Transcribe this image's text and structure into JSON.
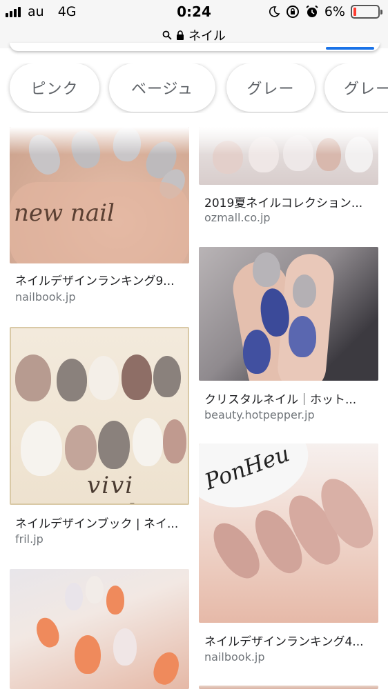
{
  "status_bar": {
    "carrier": "au",
    "network": "4G",
    "time": "0:24",
    "battery": "6%",
    "battery_level": 0.06,
    "icons": [
      "signal-bars-icon",
      "moon-icon",
      "rotation-lock-icon",
      "alarm-icon",
      "battery-icon"
    ]
  },
  "url_bar": {
    "query": "ネイル",
    "icons": [
      "search-icon",
      "lock-icon"
    ]
  },
  "chips": [
    "ピンク",
    "ベージュ",
    "グレー",
    "グレー"
  ],
  "results": {
    "left": [
      {
        "caption": "ネイルデザインランキング9...",
        "source": "nailbook.jp",
        "overlay": "new nail"
      },
      {
        "caption": "ネイルデザインブック | ネイ...",
        "source": "fril.jp",
        "overlay": "vivi nail"
      },
      {
        "caption": "",
        "source": ""
      }
    ],
    "right": [
      {
        "caption": "2019夏ネイルコレクション...",
        "source": "ozmall.co.jp"
      },
      {
        "caption": "クリスタルネイル｜ホット...",
        "source": "beauty.hotpepper.jp"
      },
      {
        "caption": "ネイルデザインランキング4...",
        "source": "nailbook.jp",
        "overlay": "PonHeu"
      }
    ]
  },
  "colors": {
    "accent": "#1a73e8",
    "battery_low": "#ff3b30",
    "source_text": "#70757a"
  }
}
